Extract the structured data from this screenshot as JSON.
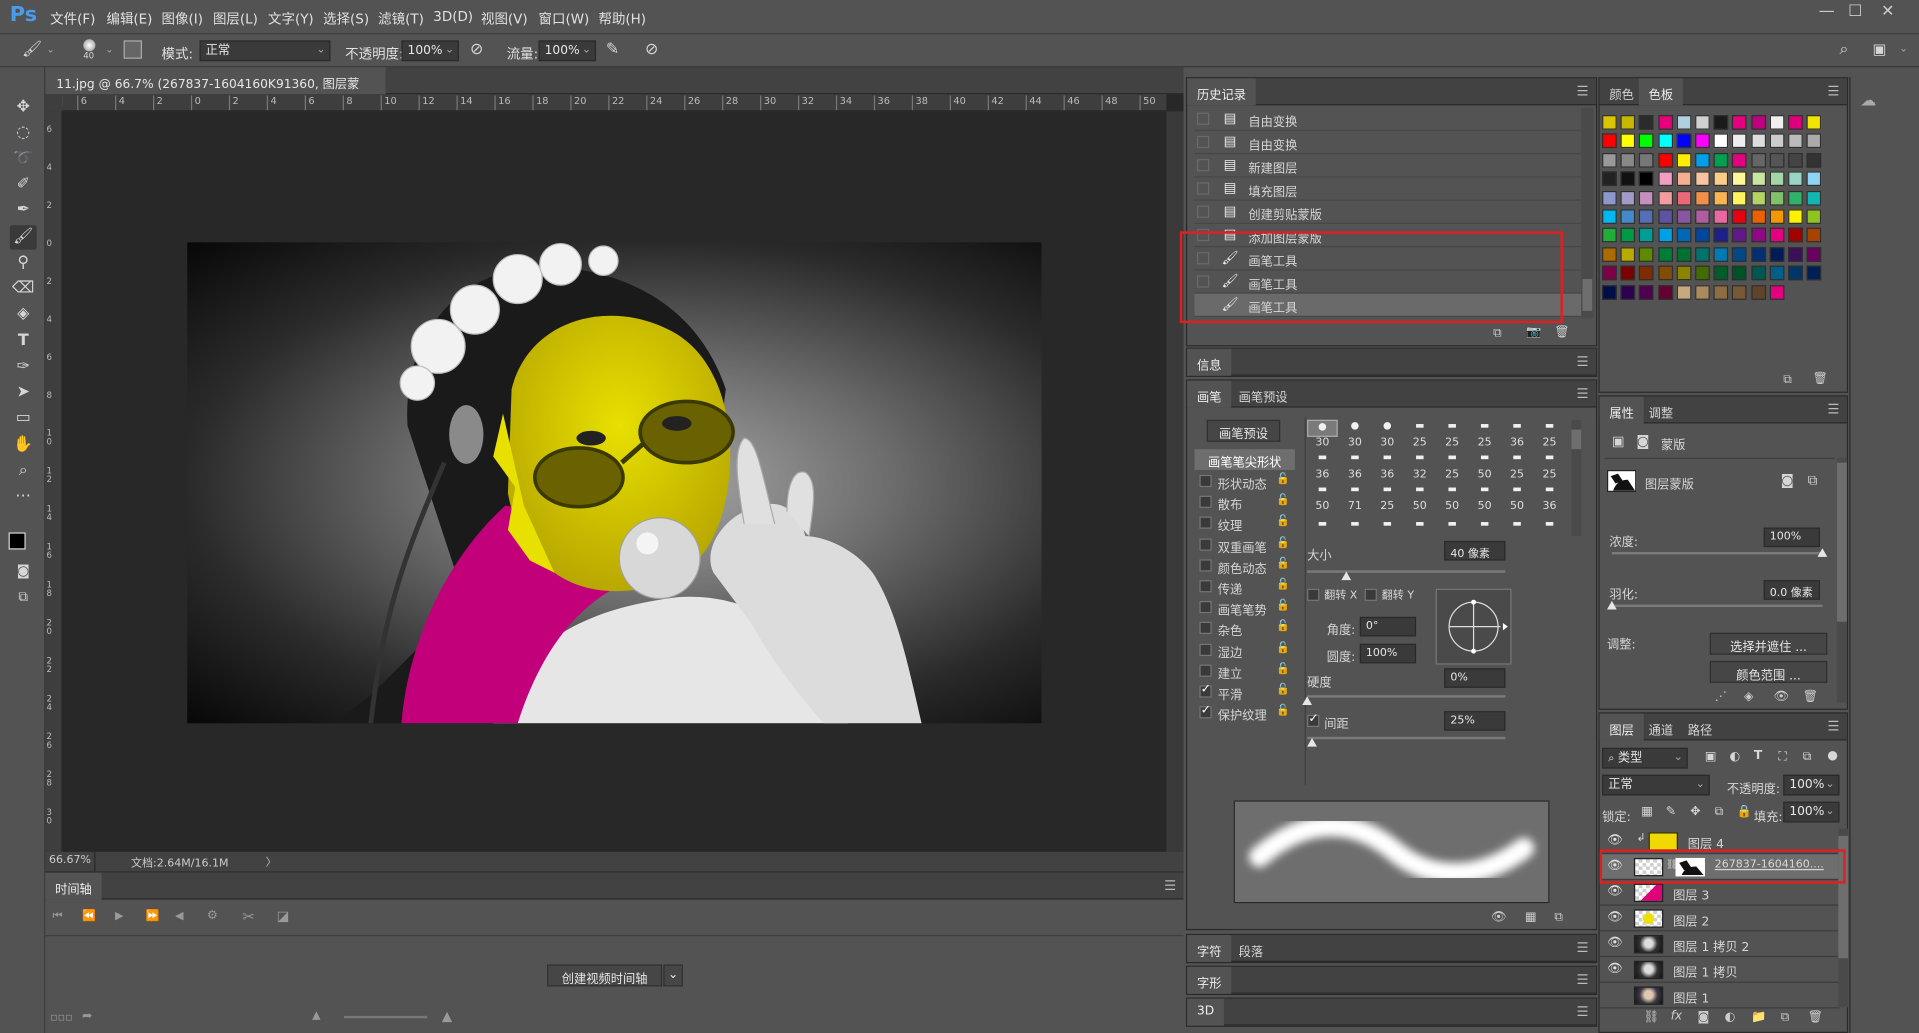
{
  "app": {
    "logo": "Ps"
  },
  "menus": [
    "文件(F)",
    "编辑(E)",
    "图像(I)",
    "图层(L)",
    "文字(Y)",
    "选择(S)",
    "滤镜(T)",
    "3D(D)",
    "视图(V)",
    "窗口(W)",
    "帮助(H)"
  ],
  "window_controls": [
    "—",
    "☐",
    "✕"
  ],
  "options": {
    "brush_size": "40",
    "mode_label": "模式:",
    "mode_value": "正常",
    "opacity_label": "不透明度:",
    "opacity_value": "100%",
    "flow_label": "流量:",
    "flow_value": "100%"
  },
  "document": {
    "tab_title": "11.jpg @ 66.7% (267837-1604160K91360, 图层蒙版/8) *",
    "tab_close": "×",
    "zoom": "66.67%",
    "doc_info": "文档:2.64M/16.1M"
  },
  "rulers": {
    "h": [
      "6",
      "4",
      "2",
      "0",
      "2",
      "4",
      "6",
      "8",
      "10",
      "12",
      "14",
      "16",
      "18",
      "20",
      "22",
      "24",
      "26",
      "28",
      "30",
      "32",
      "34",
      "36",
      "38",
      "40",
      "42",
      "44",
      "46",
      "48",
      "50"
    ],
    "v": [
      "6",
      "4",
      "2",
      "0",
      "2",
      "4",
      "6",
      "8",
      "10",
      "12",
      "14",
      "16",
      "18",
      "20",
      "22",
      "24",
      "26",
      "28",
      "30"
    ]
  },
  "timeline": {
    "tab": "时间轴",
    "create_button": "创建视频时间轴"
  },
  "history": {
    "tab": "历史记录",
    "items": [
      {
        "icon": "document-icon",
        "label": "自由变换"
      },
      {
        "icon": "document-icon",
        "label": "自由变换"
      },
      {
        "icon": "document-icon",
        "label": "新建图层"
      },
      {
        "icon": "document-icon",
        "label": "填充图层"
      },
      {
        "icon": "document-icon",
        "label": "创建剪贴蒙版"
      },
      {
        "icon": "document-icon",
        "label": "添加图层蒙版"
      },
      {
        "icon": "brush-icon",
        "label": "画笔工具"
      },
      {
        "icon": "brush-icon",
        "label": "画笔工具"
      },
      {
        "icon": "brush-icon",
        "label": "画笔工具"
      }
    ]
  },
  "info": {
    "tab": "信息"
  },
  "brush": {
    "tab_active": "画笔",
    "tab_other": "画笔预设",
    "preset_button": "画笔预设",
    "tip_shape": "画笔笔尖形状",
    "options": [
      {
        "label": "形状动态",
        "checked": false
      },
      {
        "label": "散布",
        "checked": false
      },
      {
        "label": "纹理",
        "checked": false
      },
      {
        "label": "双重画笔",
        "checked": false
      },
      {
        "label": "颜色动态",
        "checked": false
      },
      {
        "label": "传递",
        "checked": false
      },
      {
        "label": "画笔笔势",
        "checked": false
      },
      {
        "label": "杂色",
        "checked": false
      },
      {
        "label": "湿边",
        "checked": false
      },
      {
        "label": "建立",
        "checked": false
      },
      {
        "label": "平滑",
        "checked": true
      },
      {
        "label": "保护纹理",
        "checked": true
      }
    ],
    "tip_sizes": [
      "30",
      "30",
      "30",
      "25",
      "25",
      "25",
      "36",
      "25",
      "36",
      "36",
      "36",
      "32",
      "25",
      "50",
      "25",
      "25",
      "50",
      "71",
      "25",
      "50",
      "50",
      "50",
      "50",
      "36"
    ],
    "size_label": "大小",
    "size_value": "40 像素",
    "flip_x": "翻转 X",
    "flip_y": "翻转 Y",
    "angle_label": "角度:",
    "angle_value": "0°",
    "roundness_label": "圆度:",
    "roundness_value": "100%",
    "hardness_label": "硬度",
    "hardness_value": "0%",
    "spacing_label": "间距",
    "spacing_value": "25%",
    "hardness": 0,
    "spacing": 0.25
  },
  "char": {
    "tab1": "字符",
    "tab2": "段落"
  },
  "glyph": {
    "tab": "字形"
  },
  "threed": {
    "tab": "3D"
  },
  "color": {
    "tab1": "颜色",
    "tab2": "色板",
    "swatches": [
      "#d9c600",
      "#c8b900",
      "#2b2b2b",
      "#e8007a",
      "#b0d0e0",
      "#d0d0d0",
      "#1a1a1a",
      "#e6007e",
      "#c00080",
      "#f0f0f0",
      "#e0007e",
      "#f0e600",
      "#ff0000",
      "#ffff00",
      "#00ff00",
      "#00ffff",
      "#0000ff",
      "#ff00ff",
      "#ffffff",
      "#eeeeee",
      "#dddddd",
      "#cccccc",
      "#bbbbbb",
      "#aaaaaa",
      "#999999",
      "#888888",
      "#777777",
      "#ff0000",
      "#ffee00",
      "#00a0e9",
      "#00a050",
      "#e4007f",
      "#666666",
      "#555555",
      "#444444",
      "#333333",
      "#222222",
      "#111111",
      "#000000",
      "#f19ec2",
      "#f5b090",
      "#f8c3a0",
      "#facd89",
      "#fff799",
      "#c9e4a3",
      "#a3d6a7",
      "#9bd4c6",
      "#8fd3f5",
      "#8c97cb",
      "#a29bc7",
      "#c490bf",
      "#f29c9f",
      "#eb6877",
      "#f19149",
      "#f8b551",
      "#fff45c",
      "#b3d465",
      "#80c269",
      "#32b16c",
      "#13b5b1",
      "#00b7ee",
      "#448aca",
      "#556fb5",
      "#5f52a0",
      "#8957a1",
      "#ae5da1",
      "#ea68a2",
      "#e60012",
      "#eb6100",
      "#f39800",
      "#fff100",
      "#8fc31f",
      "#22ac38",
      "#009944",
      "#009e96",
      "#00a0e9",
      "#0068b7",
      "#00479d",
      "#1d2088",
      "#601986",
      "#920783",
      "#e4007f",
      "#a40000",
      "#a84200",
      "#ac6a00",
      "#b7aa00",
      "#5f8a00",
      "#007d36",
      "#007130",
      "#00736d",
      "#007bb3",
      "#004986",
      "#003070",
      "#001c58",
      "#3c0f5b",
      "#6a005f",
      "#7e0046",
      "#7d0000",
      "#7f2b00",
      "#834d00",
      "#8c8300",
      "#426c00",
      "#005d27",
      "#005226",
      "#005651",
      "#005e89",
      "#003567",
      "#002055",
      "#000d49",
      "#2e0050",
      "#4f004f",
      "#640032",
      "#c7a97e",
      "#aa8b5e",
      "#8f6d42",
      "#785836",
      "#5f4427",
      "#e4007f"
    ]
  },
  "properties": {
    "tab1": "属性",
    "tab2": "调整",
    "section": "蒙版",
    "mask_label": "图层蒙版",
    "density_label": "浓度:",
    "density_value": "100%",
    "feather_label": "羽化:",
    "feather_value": "0.0 像素",
    "adjust_label": "调整:",
    "select_mask_button": "选择并遮住 ...",
    "color_range_button": "颜色范围 ...",
    "density": 1,
    "feather": 0
  },
  "layers": {
    "tab1": "图层",
    "tab2": "通道",
    "tab3": "路径",
    "kind": "类型",
    "blend": "正常",
    "opacity_label": "不透明度:",
    "opacity_value": "100%",
    "lock_label": "锁定:",
    "fill_label": "填充:",
    "fill_value": "100%",
    "rows": [
      {
        "name": "图层 4",
        "thumb": "#f0d800",
        "visible": true,
        "clipped": true
      },
      {
        "name": "267837-1604160....",
        "thumb": "checker",
        "visible": true,
        "mask": true
      },
      {
        "name": "图层 3",
        "thumb": "checker-pink",
        "visible": true
      },
      {
        "name": "图层 2",
        "thumb": "checker-yellow",
        "visible": true
      },
      {
        "name": "图层 1 拷贝 2",
        "thumb": "photo",
        "visible": true
      },
      {
        "name": "图层 1 拷贝",
        "thumb": "photo",
        "visible": true
      },
      {
        "name": "图层 1",
        "thumb": "photo-color",
        "visible": false
      }
    ]
  }
}
